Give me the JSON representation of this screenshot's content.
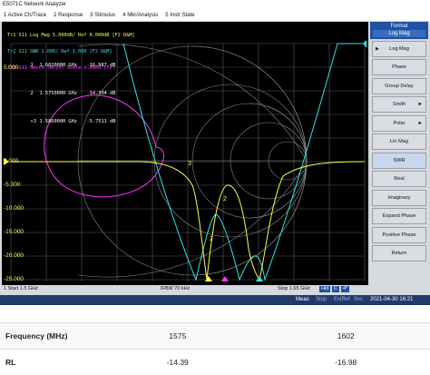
{
  "app": {
    "title": "E5071C Network Analyzer"
  },
  "menu": [
    "1 Active Ch/Trace",
    "2 Response",
    "3 Stimulus",
    "4 Mkr/Analysis",
    "5 Instr State"
  ],
  "traces": {
    "tr1": "Tr1 S11 Log Mag 5.000dB/ Ref 0.000dB [F2 D&M]",
    "tr2": "Tr2 S11 SWR 1.000/ Ref 1.000 [F2 D&M]",
    "tr3": "Tr3 S11 Smith (R+jX) Scale 1.000U [F2]"
  },
  "markers": [
    {
      "id": "1",
      "freq": "1.6020000 GHz",
      "value": "-16.987 dB"
    },
    {
      "id": "2",
      "freq": "1.5750000 GHz",
      "value": "-14.394 dB"
    },
    {
      "id": ">3",
      "freq": "1.5860000 GHz",
      "value": "-5.7511 dB"
    }
  ],
  "axis": {
    "y_ticks": [
      "5.000",
      "0.000",
      "-5.000",
      "-10.000",
      "-15.000",
      "-20.000",
      "-25.000"
    ]
  },
  "sweep": {
    "start": "1 Start 1.5 GHz",
    "ifbw": "IFBW 70 kHz",
    "stop": "Stop 1.65 GHz",
    "tags": [
      "Hld",
      "C",
      "4*"
    ]
  },
  "format_menu": {
    "header_title": "Format",
    "header_sub": "Log Mag",
    "buttons": [
      "Log Mag",
      "Phase",
      "Group Delay",
      "Smith",
      "Polar",
      "Lin Mag",
      "SWR",
      "Real",
      "Imaginary",
      "Expand Phase",
      "Positive Phase",
      "Return"
    ],
    "active": "SWR"
  },
  "status": {
    "meas": "Meas",
    "stop": "Stop",
    "extref": "ExtRef",
    "svc": "Svc",
    "datetime": "2021-04-30 16:21"
  },
  "table": {
    "rows": [
      {
        "label": "Frequency (MHz)",
        "values": [
          "1575",
          "1602"
        ]
      },
      {
        "label": "RL",
        "values": [
          "-14.39",
          "-16.98"
        ]
      }
    ]
  },
  "colors": {
    "trace1": "#ffff44",
    "trace2": "#2ee6e6",
    "trace3": "#ff33ff",
    "screen_bg": "#000000",
    "accent": "#1f52a2"
  }
}
